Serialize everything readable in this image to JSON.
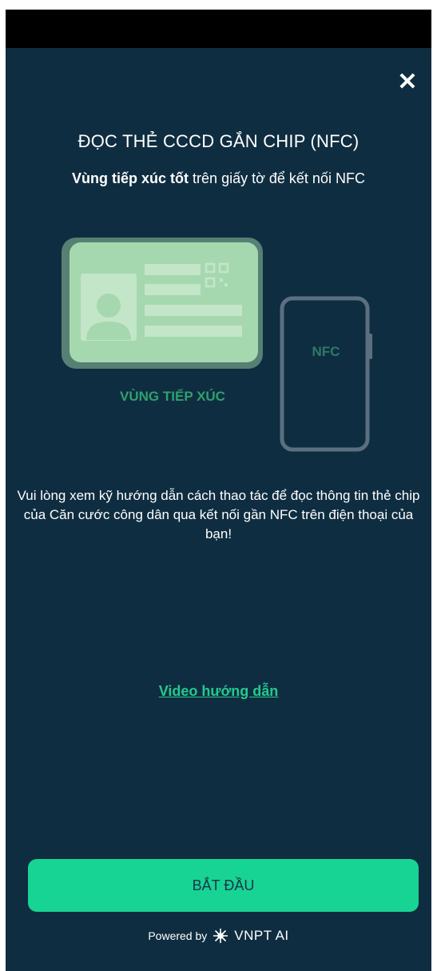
{
  "header": {
    "close_icon": "✕"
  },
  "title": "ĐỌC THẺ CCCD GẮN CHIP (NFC)",
  "subtitle": {
    "bold": "Vùng tiếp xúc tốt",
    "rest": " trên giấy tờ để kết nối NFC"
  },
  "illustration": {
    "contact_label": "VÙNG TIẾP XÚC",
    "nfc_label": "NFC",
    "card_color": "#a6d8b0",
    "phone_outline_color": "#5a6f80"
  },
  "description": "Vui lòng xem kỹ hướng dẫn cách thao tác để đọc thông tin thẻ chip của Căn cước công dân qua kết nối gần NFC trên điện thoại của bạn!",
  "video_link": "Video hướng dẫn",
  "start_button": "BẮT ĐẦU",
  "footer": {
    "powered_by": "Powered by",
    "brand": "VNPT AI"
  },
  "colors": {
    "background": "#0f2d40",
    "accent": "#17d494",
    "link": "#24c98e"
  }
}
